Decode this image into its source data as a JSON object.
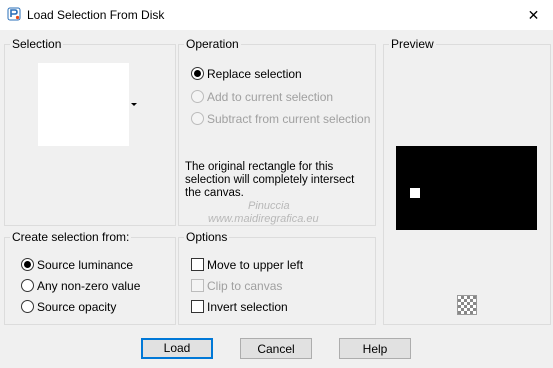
{
  "window": {
    "title": "Load Selection From Disk",
    "close_glyph": "✕"
  },
  "selection": {
    "label": "Selection"
  },
  "operation": {
    "label": "Operation",
    "options": [
      "Replace selection",
      "Add to current selection",
      "Subtract from current selection"
    ],
    "selected": "Replace selection",
    "info": "The original rectangle for this selection will completely intersect the canvas."
  },
  "preview": {
    "label": "Preview"
  },
  "create_from": {
    "label": "Create selection from:",
    "options": [
      "Source luminance",
      "Any non-zero value",
      "Source opacity"
    ],
    "selected": "Source luminance"
  },
  "options": {
    "label": "Options",
    "items": [
      "Move to upper left",
      "Clip to canvas",
      "Invert selection"
    ]
  },
  "buttons": {
    "load": "Load",
    "cancel": "Cancel",
    "help": "Help"
  },
  "watermark": {
    "line1": "Pinuccia",
    "line2": "www.maidiregrafica.eu"
  }
}
